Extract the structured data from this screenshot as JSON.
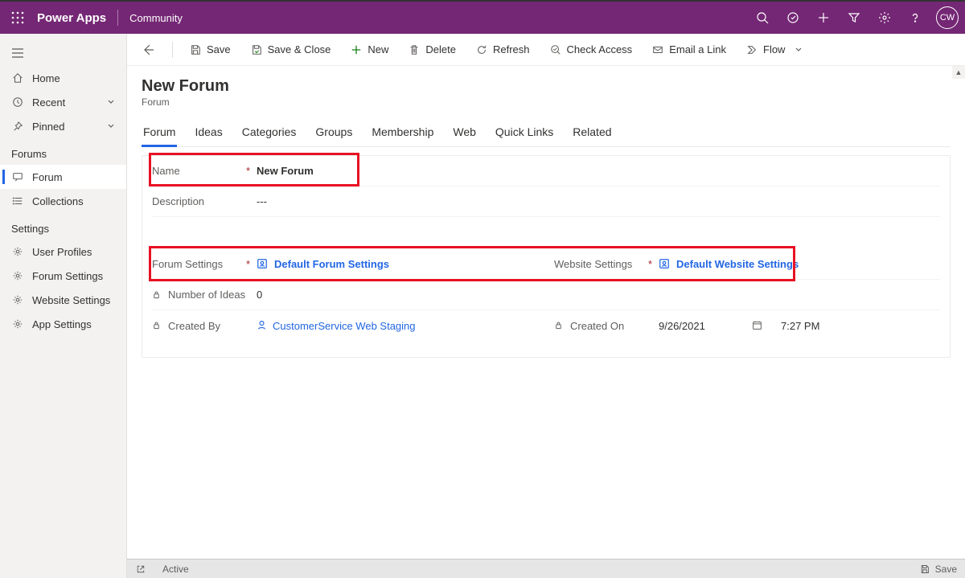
{
  "header": {
    "app_name": "Power Apps",
    "environment": "Community",
    "avatar_initials": "CW"
  },
  "leftnav": {
    "home": "Home",
    "recent": "Recent",
    "pinned": "Pinned",
    "section_forums": "Forums",
    "forum": "Forum",
    "collections": "Collections",
    "section_settings": "Settings",
    "user_profiles": "User Profiles",
    "forum_settings": "Forum Settings",
    "website_settings": "Website Settings",
    "app_settings": "App Settings"
  },
  "commands": {
    "save": "Save",
    "save_close": "Save & Close",
    "new": "New",
    "delete": "Delete",
    "refresh": "Refresh",
    "check_access": "Check Access",
    "email_link": "Email a Link",
    "flow": "Flow"
  },
  "page": {
    "title": "New Forum",
    "subtitle": "Forum"
  },
  "tabs": {
    "forum": "Forum",
    "ideas": "Ideas",
    "categories": "Categories",
    "groups": "Groups",
    "membership": "Membership",
    "web": "Web",
    "quick_links": "Quick Links",
    "related": "Related"
  },
  "form": {
    "name_label": "Name",
    "name_value": "New Forum",
    "description_label": "Description",
    "description_value": "---",
    "forum_settings_label": "Forum Settings",
    "forum_settings_value": "Default Forum Settings",
    "website_settings_label": "Website Settings",
    "website_settings_value": "Default Website Settings",
    "number_ideas_label": "Number of Ideas",
    "number_ideas_value": "0",
    "created_by_label": "Created By",
    "created_by_value": "CustomerService Web Staging",
    "created_on_label": "Created On",
    "created_on_date": "9/26/2021",
    "created_on_time": "7:27 PM"
  },
  "status": {
    "state": "Active",
    "save": "Save"
  }
}
